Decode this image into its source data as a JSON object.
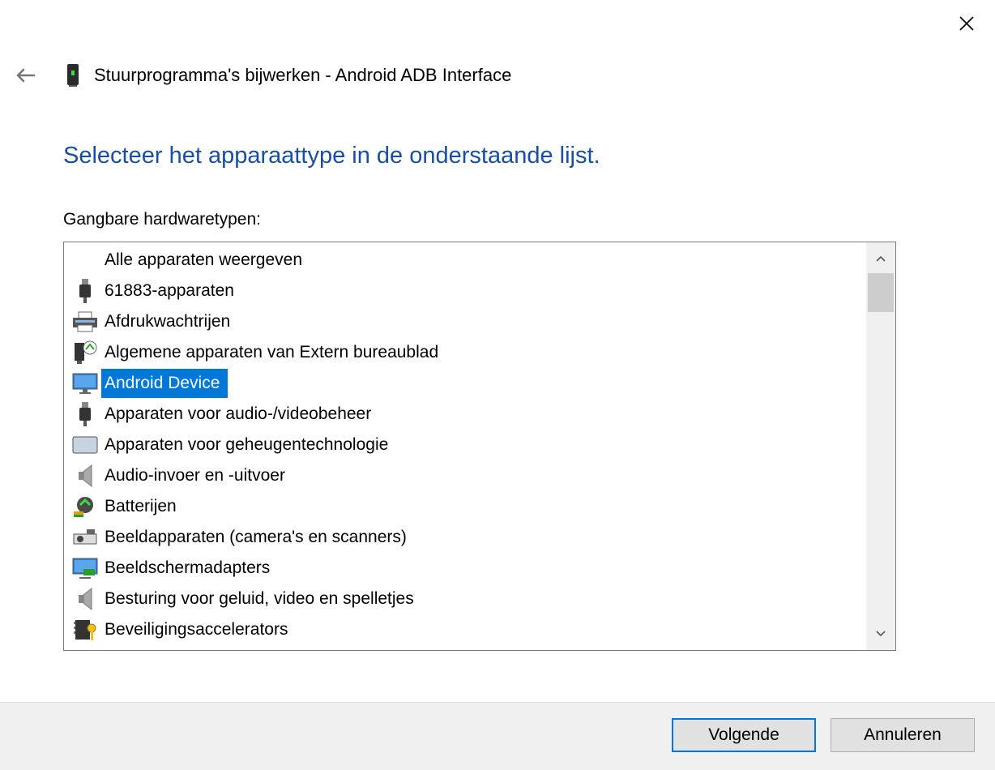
{
  "window": {
    "title": "Stuurprogramma's bijwerken - Android ADB Interface"
  },
  "heading": "Selecteer het apparaattype in de onderstaande lijst.",
  "list": {
    "label": "Gangbare hardwaretypen:",
    "items": [
      {
        "label": "Alle apparaten weergeven",
        "icon": "none",
        "selected": false
      },
      {
        "label": "61883-apparaten",
        "icon": "usb-plug-icon",
        "selected": false
      },
      {
        "label": "Afdrukwachtrijen",
        "icon": "printer-icon",
        "selected": false
      },
      {
        "label": "Algemene apparaten van Extern bureaublad",
        "icon": "remote-desktop-icon",
        "selected": false
      },
      {
        "label": "Android Device",
        "icon": "monitor-icon",
        "selected": true
      },
      {
        "label": "Apparaten voor audio-/videobeheer",
        "icon": "usb-plug-icon",
        "selected": false
      },
      {
        "label": "Apparaten voor geheugentechnologie",
        "icon": "memory-card-icon",
        "selected": false
      },
      {
        "label": "Audio-invoer en -uitvoer",
        "icon": "speaker-icon",
        "selected": false
      },
      {
        "label": "Batterijen",
        "icon": "battery-icon",
        "selected": false
      },
      {
        "label": "Beeldapparaten (camera's en scanners)",
        "icon": "camera-icon",
        "selected": false
      },
      {
        "label": "Beeldschermadapters",
        "icon": "display-adapter-icon",
        "selected": false
      },
      {
        "label": "Besturing voor geluid, video en spelletjes",
        "icon": "speaker-icon",
        "selected": false
      },
      {
        "label": "Beveiligingsaccelerators",
        "icon": "security-chip-icon",
        "selected": false
      }
    ]
  },
  "buttons": {
    "next": "Volgende",
    "cancel": "Annuleren"
  },
  "colors": {
    "heading": "#1a4fa0",
    "selection": "#0078d7",
    "footer": "#f0f0f0"
  }
}
